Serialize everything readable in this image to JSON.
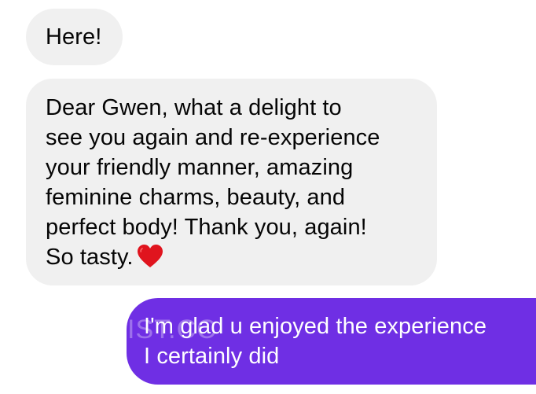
{
  "messages": [
    {
      "direction": "incoming",
      "lines": [
        "Here!"
      ]
    },
    {
      "direction": "incoming",
      "lines": [
        "Dear Gwen, what a delight to",
        "see you again and re-experience",
        "your friendly manner, amazing",
        "feminine charms, beauty, and",
        "perfect body! Thank you, again!",
        "So tasty."
      ],
      "emoji": "red-heart"
    },
    {
      "direction": "outgoing",
      "lines": [
        "I'm glad u enjoyed the experience",
        "I certainly did"
      ]
    }
  ],
  "watermark": "IST.CC",
  "colors": {
    "incoming_bubble": "#f0f0f0",
    "incoming_text": "#050505",
    "outgoing_bubble": "#6f2fe4",
    "outgoing_text": "#ffffff",
    "heart": "#e0141e"
  }
}
